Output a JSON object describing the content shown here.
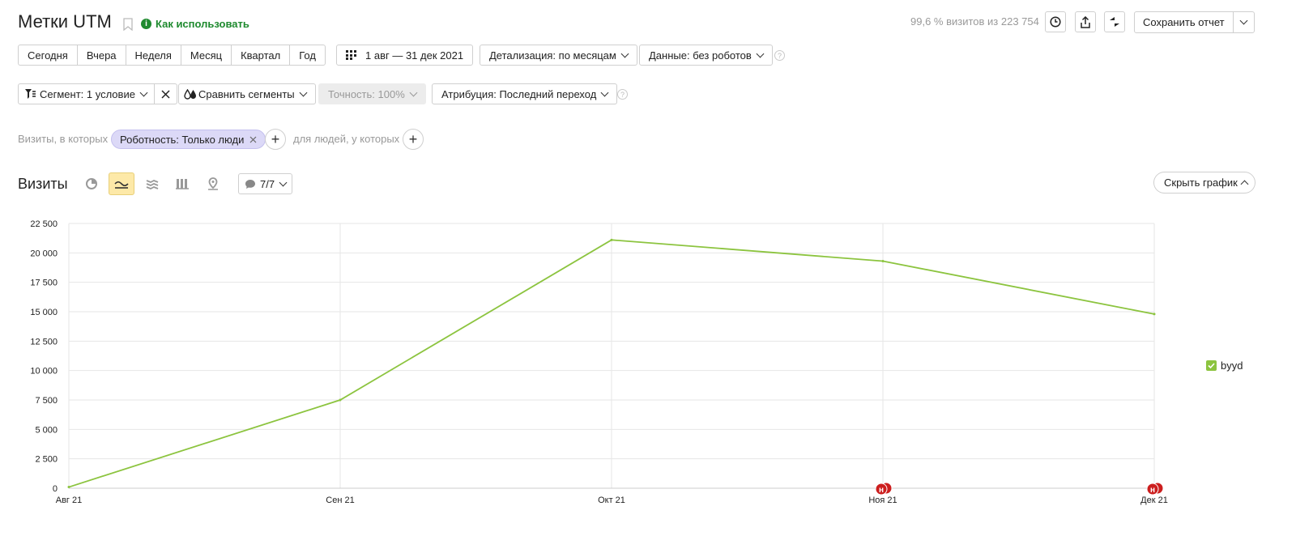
{
  "header": {
    "title": "Метки UTM",
    "howto_label": "Как использовать",
    "visits_info": "99,6 % визитов из 223 754",
    "save_report_label": "Сохранить отчет"
  },
  "period_buttons": [
    "Сегодня",
    "Вчера",
    "Неделя",
    "Месяц",
    "Квартал",
    "Год"
  ],
  "date_range": "1 авг — 31 дек 2021",
  "detail_label": "Детализация: по месяцам",
  "data_label": "Данные: без роботов",
  "segment_label": "Сегмент: 1 условие",
  "compare_label": "Сравнить сегменты",
  "accuracy_label": "Точность: 100%",
  "attribution_label": "Атрибуция: Последний переход",
  "filter": {
    "prefix": "Визиты, в которых",
    "chip": "Роботность: Только люди",
    "middle": "для людей, у которых"
  },
  "section": {
    "title": "Визиты",
    "comments_count": "7/7",
    "hide_chart_label": "Скрыть график"
  },
  "colors": {
    "line": "#8cc43f",
    "accent_green": "#1e8a2e",
    "marker": "#cc1e1e",
    "active_view": "#fde9a8"
  },
  "chart_data": {
    "type": "line",
    "categories": [
      "Авг 21",
      "Сен 21",
      "Окт 21",
      "Ноя 21",
      "Дек 21"
    ],
    "series": [
      {
        "name": "byyd",
        "values": [
          100,
          7500,
          21100,
          19300,
          14800
        ]
      }
    ],
    "yticks": [
      "0",
      "2 500",
      "5 000",
      "7 500",
      "10 000",
      "12 500",
      "15 000",
      "17 500",
      "20 000",
      "22 500"
    ],
    "ylim": [
      0,
      22500
    ],
    "grid": true,
    "legend": "right",
    "markers": [
      {
        "category": "Ноя 21",
        "label": "н"
      },
      {
        "category": "Дек 21",
        "label": "н"
      }
    ]
  }
}
